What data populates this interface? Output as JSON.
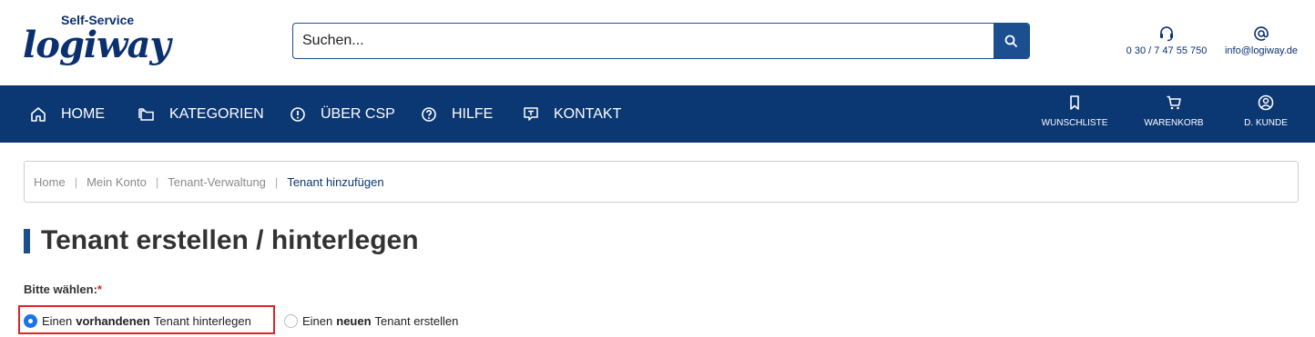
{
  "header": {
    "logo": {
      "top_text": "Self-Service",
      "main_text": "logiway"
    },
    "search": {
      "placeholder": "Suchen..."
    },
    "contact": {
      "phone": "0 30 / 7 47 55 750",
      "email": "info@logiway.de"
    }
  },
  "nav": {
    "items": [
      {
        "label": "HOME",
        "icon": "home-icon"
      },
      {
        "label": "KATEGORIEN",
        "icon": "folders-icon"
      },
      {
        "label": "ÜBER CSP",
        "icon": "info-icon"
      },
      {
        "label": "HILFE",
        "icon": "help-icon"
      },
      {
        "label": "KONTAKT",
        "icon": "chat-icon"
      }
    ],
    "right": [
      {
        "label": "WUNSCHLISTE",
        "icon": "bookmark-icon"
      },
      {
        "label": "WARENKORB",
        "icon": "cart-icon"
      },
      {
        "label": "D. KUNDE",
        "icon": "user-icon"
      }
    ]
  },
  "breadcrumb": [
    "Home",
    "Mein Konto",
    "Tenant-Verwaltung",
    "Tenant hinzufügen"
  ],
  "page": {
    "title": "Tenant erstellen / hinterlegen",
    "choice_label": "Bitte wählen:",
    "required_mark": "*",
    "options": [
      {
        "pre": "Einen",
        "bold": "vorhandenen",
        "post": "Tenant hinterlegen",
        "selected": true
      },
      {
        "pre": "Einen",
        "bold": "neuen",
        "post": "Tenant erstellen",
        "selected": false
      }
    ]
  },
  "colors": {
    "brand": "#0b3773",
    "accent": "#1c4f8f",
    "highlight": "#d9262a",
    "radio": "#1a73e8"
  }
}
